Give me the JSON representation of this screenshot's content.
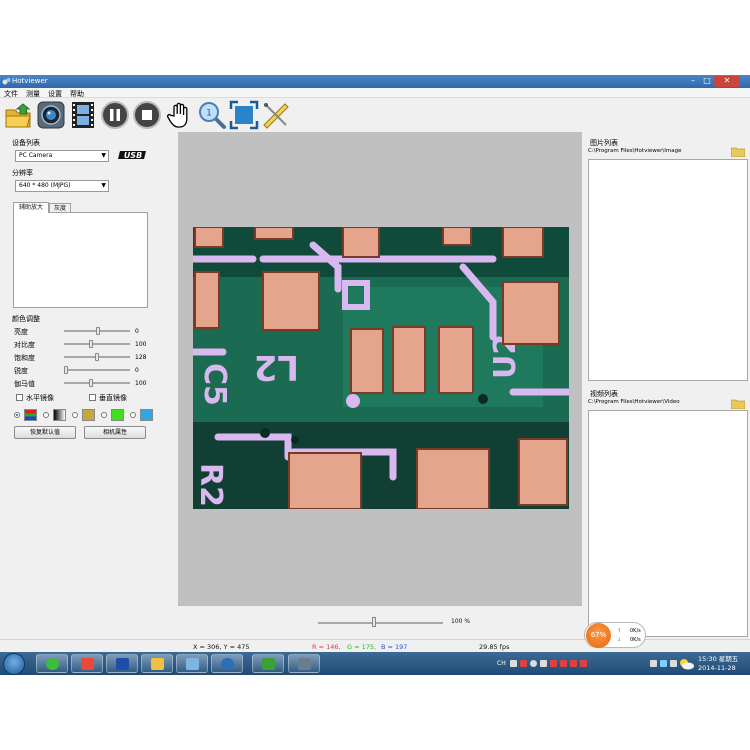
{
  "window": {
    "title": "Hotviewer"
  },
  "menu": {
    "items": [
      "文件",
      "测量",
      "设置",
      "帮助"
    ]
  },
  "toolbar": {
    "buttons": [
      "open-folder-icon",
      "camera-snapshot-icon",
      "video-record-icon",
      "pause-icon",
      "stop-icon",
      "pan-hand-icon",
      "zoom-magnifier-icon",
      "fit-window-icon",
      "measure-ruler-icon"
    ]
  },
  "left": {
    "device_label": "设备列表",
    "device_value": "PC Camera",
    "usb_logo": "USB",
    "resolution_label": "分辨率",
    "resolution_value": "640 * 480 (MJPG)",
    "tabs": [
      "辅助放大",
      "灰度"
    ],
    "color_section": "颜色调整",
    "sliders": [
      {
        "label": "亮度",
        "value": "0",
        "fraction": 0.52
      },
      {
        "label": "对比度",
        "value": "100",
        "fraction": 0.4
      },
      {
        "label": "饱和度",
        "value": "128",
        "fraction": 0.5
      },
      {
        "label": "锐度",
        "value": "0",
        "fraction": 0.0
      },
      {
        "label": "伽马值",
        "value": "100",
        "fraction": 0.4
      }
    ],
    "mirror_h": "水平镜像",
    "mirror_v": "垂直镜像",
    "reset_button": "恢复默认值",
    "camera_props_button": "相机属性"
  },
  "center": {
    "zoom": "100 %",
    "zoom_fraction": 0.45
  },
  "right": {
    "image_list_label": "图片列表",
    "image_path": "C:\\Program Files\\Hotviewer\\Image",
    "video_list_label": "视频列表",
    "video_path": "C:\\Program Files\\Hotviewer\\Video"
  },
  "status": {
    "coords": "X = 306, Y = 475",
    "r": "R = 146,",
    "g": "G = 175,",
    "b": "B = 197",
    "fps": "29.85 fps"
  },
  "net_widget": {
    "percent": "67%",
    "up": "0K/s",
    "down": "0K/s"
  },
  "taskbar": {
    "tray_ch": "CH",
    "time": "15:30 星期五",
    "date": "2014-11-28"
  },
  "colors": {
    "accent": "#2f69ac",
    "pcb_green": "#1b6a52",
    "pad_copper": "#e5a48c",
    "silkscreen": "#d9b8f0"
  }
}
